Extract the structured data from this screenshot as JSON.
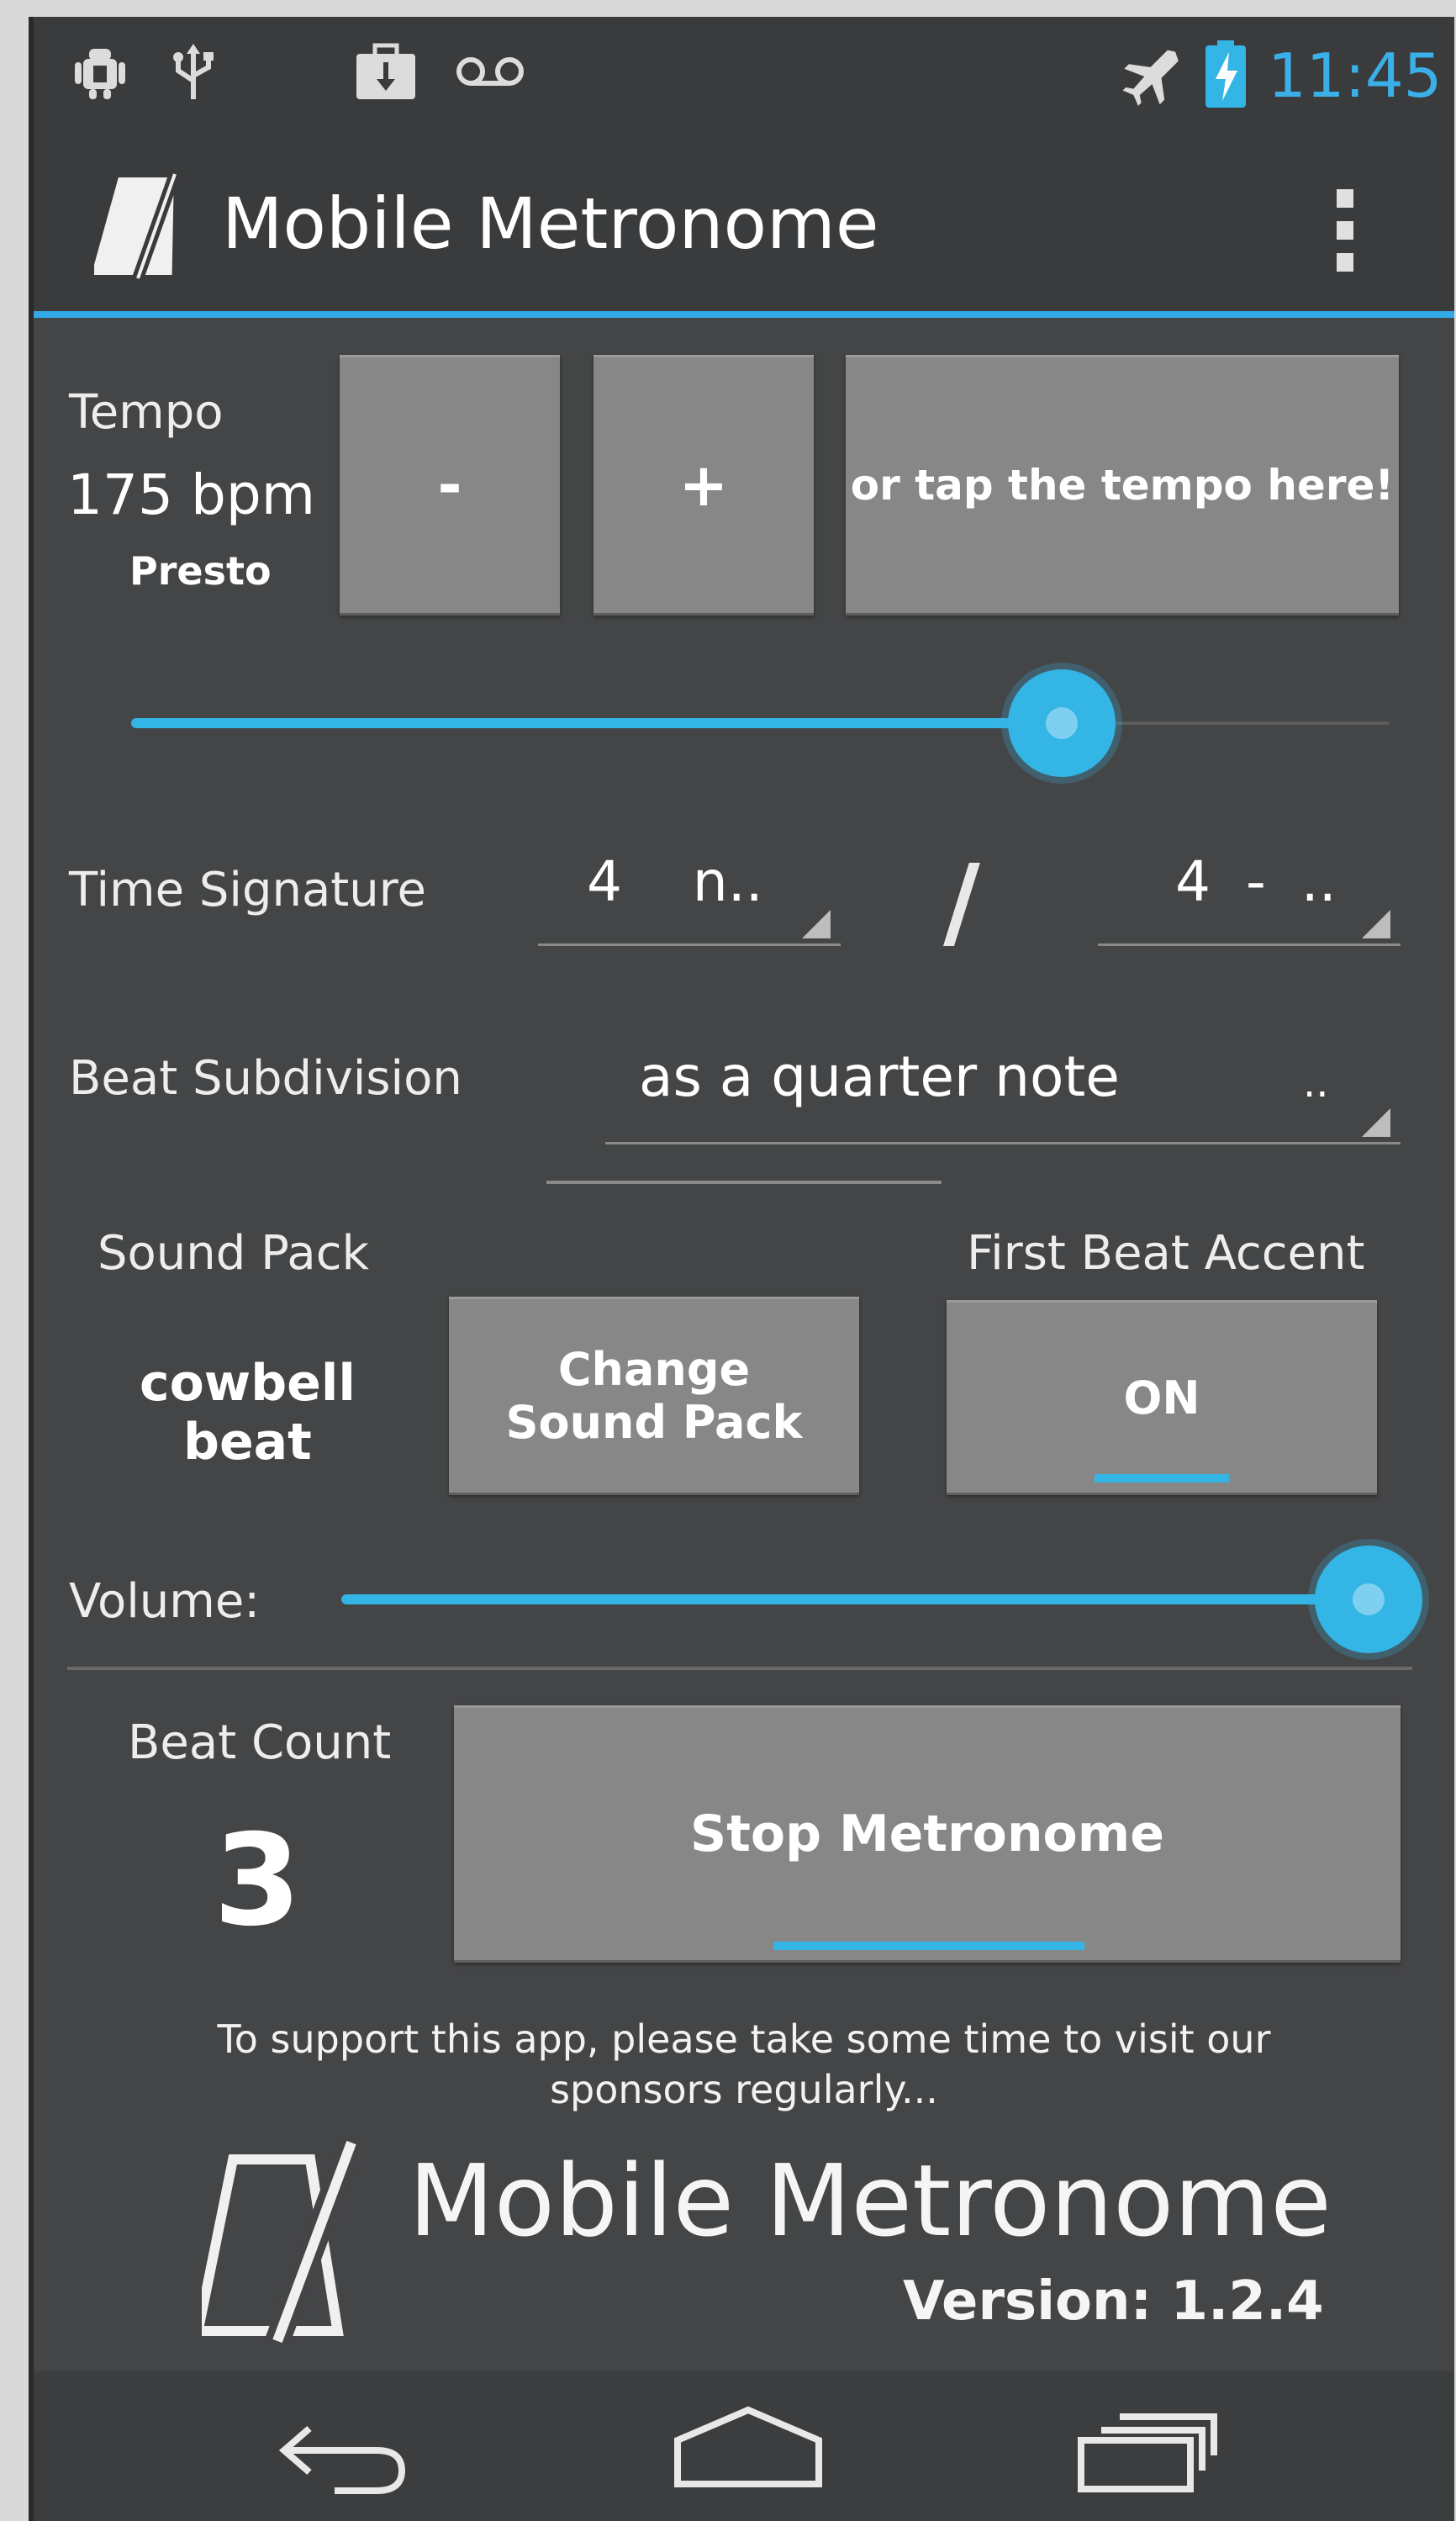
{
  "status_bar": {
    "icons": [
      "android-debug-icon",
      "usb-icon",
      "download-icon",
      "voicemail-icon",
      "airplane-mode-icon",
      "battery-charging-icon"
    ],
    "time": "11:45"
  },
  "action_bar": {
    "app_title": "Mobile Metronome",
    "menu_icon": "overflow-menu-icon"
  },
  "tempo": {
    "label": "Tempo",
    "bpm": "175 bpm",
    "marking": "Presto",
    "minus_label": "-",
    "plus_label": "+",
    "tap_label": "or tap the tempo here!",
    "slider_fraction": 0.74
  },
  "time_signature": {
    "label": "Time Signature",
    "numerator": "4    n..",
    "separator": "/",
    "denominator": "4  -  .."
  },
  "beat_subdivision": {
    "label": "Beat Subdivision",
    "value": "as a quarter note",
    "ellipsis": ".."
  },
  "sound_pack": {
    "label": "Sound Pack",
    "current_line1": "cowbell",
    "current_line2": "beat",
    "change_line1": "Change",
    "change_line2": "Sound Pack"
  },
  "accent": {
    "label": "First Beat Accent",
    "toggle_label": "ON"
  },
  "volume": {
    "label": "Volume:",
    "slider_fraction": 1.0
  },
  "beat_count": {
    "label": "Beat Count",
    "value": "3"
  },
  "transport": {
    "stop_label": "Stop Metronome"
  },
  "footer": {
    "support_line1": "To support this app, please take some time to visit our",
    "support_line2": "sponsors regularly...",
    "brand_title": "Mobile Metronome",
    "version": "Version:  1.2.4"
  },
  "nav_bar": {
    "icons": [
      "back-icon",
      "home-icon",
      "recent-apps-icon"
    ]
  },
  "colors": {
    "accent": "#33b5e5",
    "background": "#444546",
    "button": "#878787"
  }
}
